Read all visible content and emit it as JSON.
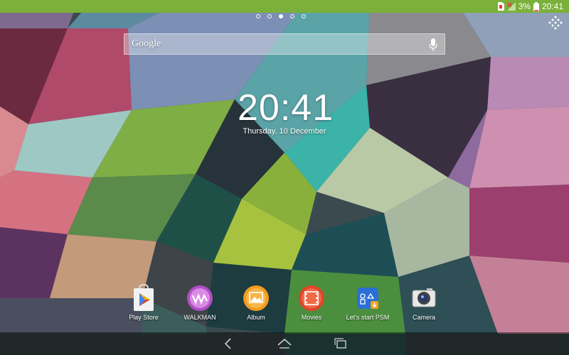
{
  "status": {
    "battery_percent": "3%",
    "time": "20:41",
    "icons": [
      "sd-card-error-icon",
      "no-signal-icon",
      "battery-charging-icon"
    ]
  },
  "home": {
    "pages_total": 5,
    "active_page": 3,
    "search": {
      "label": "Google",
      "icon": "mic-icon"
    },
    "clock": {
      "time": "20:41",
      "date": "Thursday, 10 December"
    },
    "apps_button_icon": "apps-grid-icon"
  },
  "dock": {
    "apps": [
      {
        "name": "Play Store",
        "icon": "play-store-icon"
      },
      {
        "name": "WALKMAN",
        "icon": "walkman-icon"
      },
      {
        "name": "Album",
        "icon": "album-icon"
      },
      {
        "name": "Movies",
        "icon": "movies-icon"
      },
      {
        "name": "Let's start PSM",
        "icon": "psm-icon"
      },
      {
        "name": "Camera",
        "icon": "camera-icon"
      }
    ]
  },
  "navbar": {
    "icons": [
      "back-icon",
      "home-icon",
      "recents-icon"
    ]
  }
}
